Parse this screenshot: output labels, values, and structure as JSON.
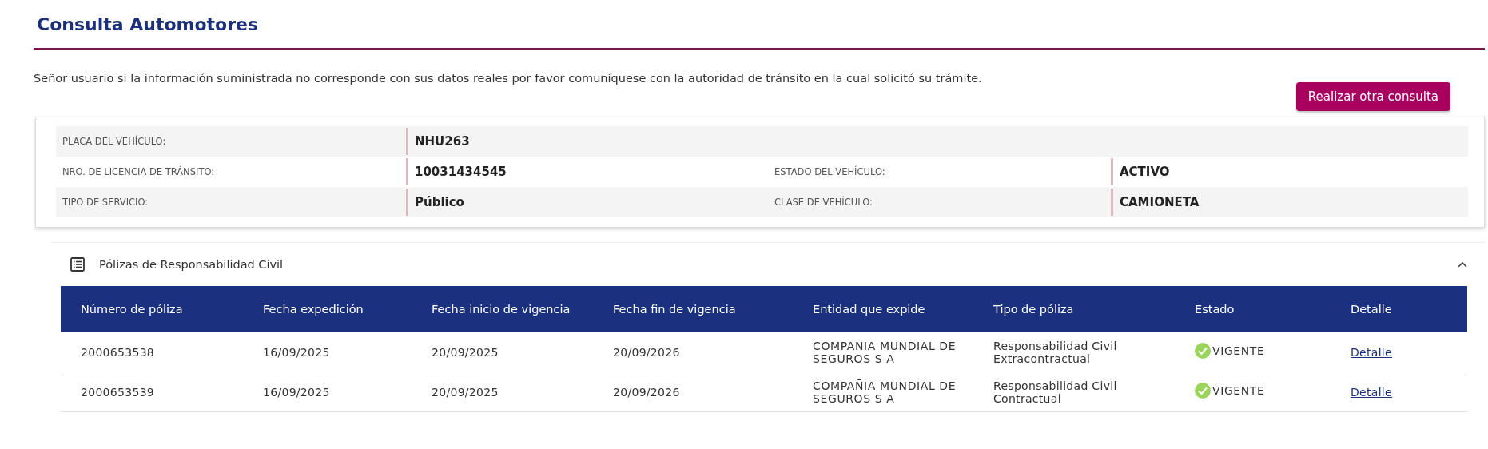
{
  "page_title": "Consulta Automotores",
  "notice": "Señor usuario si la información suministrada no corresponde con sus datos reales por favor comuníquese con la autoridad de tránsito en la cual solicitó su trámite.",
  "new_query_button": "Realizar otra consulta",
  "vehicle_info": [
    [
      {
        "label": "PLACA DEL VEHÍCULO:",
        "value": "NHU263"
      }
    ],
    [
      {
        "label": "NRO. DE LICENCIA DE TRÁNSITO:",
        "value": "10031434545"
      },
      {
        "label": "ESTADO DEL VEHÍCULO:",
        "value": "ACTIVO"
      }
    ],
    [
      {
        "label": "TIPO DE SERVICIO:",
        "value": "Público"
      },
      {
        "label": "CLASE DE VEHÍCULO:",
        "value": "CAMIONETA"
      }
    ]
  ],
  "policies": {
    "title": "Pólizas de Responsabilidad Civil",
    "expanded": true,
    "columns": [
      "Número de póliza",
      "Fecha expedición",
      "Fecha inicio de vigencia",
      "Fecha fin de vigencia",
      "Entidad que expide",
      "Tipo de póliza",
      "Estado",
      "Detalle"
    ],
    "rows": [
      {
        "number": "2000653538",
        "issued": "16/09/2025",
        "start": "20/09/2025",
        "end": "20/09/2026",
        "entity": "COMPAÑIA MUNDIAL DE SEGUROS S A",
        "type": "Responsabilidad Civil Extracontractual",
        "status": "VIGENTE",
        "valid": true,
        "detail": "Detalle"
      },
      {
        "number": "2000653539",
        "issued": "16/09/2025",
        "start": "20/09/2025",
        "end": "20/09/2026",
        "entity": "COMPAÑIA MUNDIAL DE SEGUROS S A",
        "type": "Responsabilidad Civil Contractual",
        "status": "VIGENTE",
        "valid": true,
        "detail": "Detalle"
      }
    ]
  }
}
